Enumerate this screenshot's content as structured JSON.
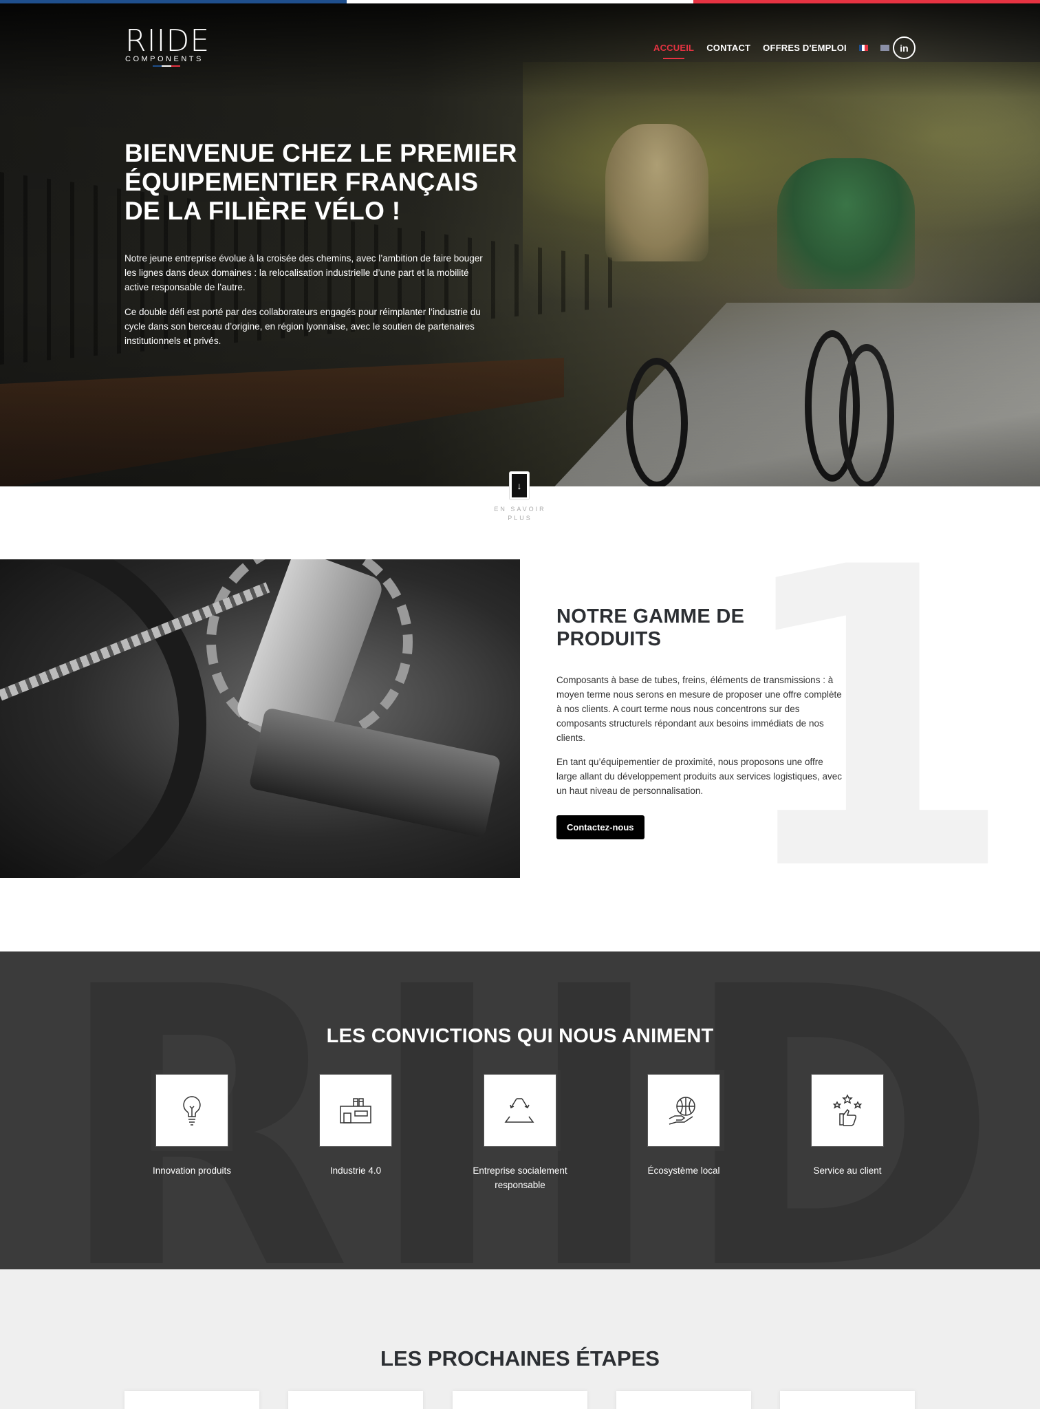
{
  "colors": {
    "blue": "#1f4f8d",
    "white": "#ffffff",
    "red": "#e63342",
    "dark": "#3b3b3b"
  },
  "logo": {
    "mark": "RIIDE",
    "sub": "COMPONENTS"
  },
  "nav": {
    "items": [
      {
        "label": "ACCUEIL",
        "active": true
      },
      {
        "label": "CONTACT",
        "active": false
      },
      {
        "label": "OFFRES D'EMPLOI",
        "active": false
      }
    ],
    "flags": [
      "fr-flag-icon",
      "en-flag-icon"
    ],
    "linkedin": "in"
  },
  "hero": {
    "title_lines": [
      "BIENVENUE CHEZ LE PREMIER",
      "ÉQUIPEMENTIER FRANÇAIS",
      "DE LA FILIÈRE VÉLO !"
    ],
    "paragraph1_lines": [
      "Notre jeune entreprise évolue à la croisée des chemins, avec l’ambition de faire bouger",
      "les lignes dans deux domaines : la relocalisation industrielle d’une part et la mobilité",
      "active responsable de l’autre."
    ],
    "paragraph2_lines": [
      "Ce double défi est porté par des collaborateurs engagés pour réimplanter l’industrie du",
      "cycle dans son berceau d’origine, en région lyonnaise, avec le soutien de partenaires",
      "institutionnels et privés."
    ],
    "scroll_arrow": "↓",
    "scroll_label_lines": [
      "EN SAVOIR",
      "PLUS"
    ]
  },
  "products": {
    "title": "NOTRE GAMME DE PRODUITS",
    "paragraph1_lines": [
      "Composants à base de tubes, freins, éléments de transmissions : à",
      "moyen terme nous serons en mesure de proposer une offre complète",
      "à nos clients. A court terme nous nous concentrons sur des",
      "composants structurels répondant aux besoins immédiats de nos",
      "clients."
    ],
    "paragraph2_lines": [
      "En tant qu’équipementier de proximité, nous proposons une offre",
      "large allant du développement produits aux services logistiques, avec",
      "un haut niveau de personnalisation."
    ],
    "button": "Contactez-nous",
    "watermark": "1"
  },
  "convictions": {
    "title": "LES CONVICTIONS QUI NOUS ANIMENT",
    "watermark": "RIIDE",
    "items": [
      {
        "label_lines": [
          "Innovation produits"
        ],
        "icon": "lightbulb-icon"
      },
      {
        "label_lines": [
          "Industrie 4.0"
        ],
        "icon": "factory-icon"
      },
      {
        "label_lines": [
          "Entreprise socialement",
          "responsable"
        ],
        "icon": "recycle-icon"
      },
      {
        "label_lines": [
          "Écosystème local"
        ],
        "icon": "globe-hand-icon"
      },
      {
        "label_lines": [
          "Service au client"
        ],
        "icon": "thumbs-up-stars-icon"
      }
    ]
  },
  "next_steps": {
    "title": "LES PROCHAINES ÉTAPES"
  }
}
